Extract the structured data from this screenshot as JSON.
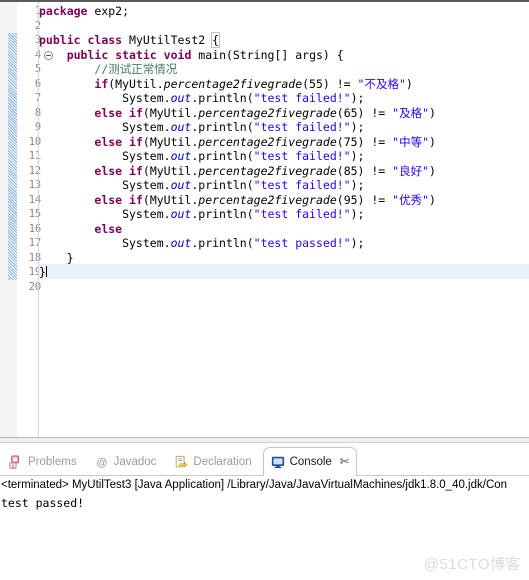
{
  "editor": {
    "gutter_start_line": 1,
    "total_lines": 20,
    "highlighted_line": 19,
    "fold_marker_line": 4,
    "change_bar_from_line": 3,
    "change_bar_to_line": 19,
    "colors": {
      "keyword": "#7f0055",
      "string": "#2a00ff",
      "comment": "#3f7f5f",
      "field": "#0000c0",
      "background": "#ffffff",
      "line_number": "#888888",
      "current_line_highlight": "#e8f2fe",
      "change_bar": "#c3d9f0"
    },
    "lines": [
      {
        "n": "1",
        "indent": 0,
        "tokens": [
          {
            "t": "package",
            "c": "kw"
          },
          {
            "t": " exp2;",
            "c": ""
          }
        ]
      },
      {
        "n": "2",
        "indent": 0,
        "tokens": []
      },
      {
        "n": "3",
        "indent": 0,
        "tokens": [
          {
            "t": "public",
            "c": "kw"
          },
          {
            "t": " ",
            "c": ""
          },
          {
            "t": "class",
            "c": "kw"
          },
          {
            "t": " MyUtilTest2 ",
            "c": ""
          },
          {
            "t": "{",
            "c": "brk"
          }
        ]
      },
      {
        "n": "4",
        "indent": 0,
        "tokens": [
          {
            "t": "    ",
            "c": ""
          },
          {
            "t": "public",
            "c": "kw"
          },
          {
            "t": " ",
            "c": ""
          },
          {
            "t": "static",
            "c": "kw"
          },
          {
            "t": " ",
            "c": ""
          },
          {
            "t": "void",
            "c": "kw"
          },
          {
            "t": " main(String[] args) {",
            "c": ""
          }
        ]
      },
      {
        "n": "5",
        "indent": 0,
        "tokens": [
          {
            "t": "        ",
            "c": ""
          },
          {
            "t": "//测试正常情况",
            "c": "cmt"
          }
        ]
      },
      {
        "n": "6",
        "indent": 0,
        "tokens": [
          {
            "t": "        ",
            "c": ""
          },
          {
            "t": "if",
            "c": "kw"
          },
          {
            "t": "(MyUtil.",
            "c": ""
          },
          {
            "t": "percentage2fivegrade",
            "c": "mth"
          },
          {
            "t": "(55) != ",
            "c": ""
          },
          {
            "t": "\"不及格\"",
            "c": "str"
          },
          {
            "t": ")",
            "c": ""
          }
        ]
      },
      {
        "n": "7",
        "indent": 0,
        "tokens": [
          {
            "t": "            System.",
            "c": ""
          },
          {
            "t": "out",
            "c": "fld"
          },
          {
            "t": ".println(",
            "c": ""
          },
          {
            "t": "\"test failed!\"",
            "c": "str"
          },
          {
            "t": ");",
            "c": ""
          }
        ]
      },
      {
        "n": "8",
        "indent": 0,
        "tokens": [
          {
            "t": "        ",
            "c": ""
          },
          {
            "t": "else",
            "c": "kw"
          },
          {
            "t": " ",
            "c": ""
          },
          {
            "t": "if",
            "c": "kw"
          },
          {
            "t": "(MyUtil.",
            "c": ""
          },
          {
            "t": "percentage2fivegrade",
            "c": "mth"
          },
          {
            "t": "(65) != ",
            "c": ""
          },
          {
            "t": "\"及格\"",
            "c": "str"
          },
          {
            "t": ")",
            "c": ""
          }
        ]
      },
      {
        "n": "9",
        "indent": 0,
        "tokens": [
          {
            "t": "            System.",
            "c": ""
          },
          {
            "t": "out",
            "c": "fld"
          },
          {
            "t": ".println(",
            "c": ""
          },
          {
            "t": "\"test failed!\"",
            "c": "str"
          },
          {
            "t": ");",
            "c": ""
          }
        ]
      },
      {
        "n": "10",
        "indent": 0,
        "tokens": [
          {
            "t": "        ",
            "c": ""
          },
          {
            "t": "else",
            "c": "kw"
          },
          {
            "t": " ",
            "c": ""
          },
          {
            "t": "if",
            "c": "kw"
          },
          {
            "t": "(MyUtil.",
            "c": ""
          },
          {
            "t": "percentage2fivegrade",
            "c": "mth"
          },
          {
            "t": "(75) != ",
            "c": ""
          },
          {
            "t": "\"中等\"",
            "c": "str"
          },
          {
            "t": ")",
            "c": ""
          }
        ]
      },
      {
        "n": "11",
        "indent": 0,
        "tokens": [
          {
            "t": "            System.",
            "c": ""
          },
          {
            "t": "out",
            "c": "fld"
          },
          {
            "t": ".println(",
            "c": ""
          },
          {
            "t": "\"test failed!\"",
            "c": "str"
          },
          {
            "t": ");",
            "c": ""
          }
        ]
      },
      {
        "n": "12",
        "indent": 0,
        "tokens": [
          {
            "t": "        ",
            "c": ""
          },
          {
            "t": "else",
            "c": "kw"
          },
          {
            "t": " ",
            "c": ""
          },
          {
            "t": "if",
            "c": "kw"
          },
          {
            "t": "(MyUtil.",
            "c": ""
          },
          {
            "t": "percentage2fivegrade",
            "c": "mth"
          },
          {
            "t": "(85) != ",
            "c": ""
          },
          {
            "t": "\"良好\"",
            "c": "str"
          },
          {
            "t": ")",
            "c": ""
          }
        ]
      },
      {
        "n": "13",
        "indent": 0,
        "tokens": [
          {
            "t": "            System.",
            "c": ""
          },
          {
            "t": "out",
            "c": "fld"
          },
          {
            "t": ".println(",
            "c": ""
          },
          {
            "t": "\"test failed!\"",
            "c": "str"
          },
          {
            "t": ");",
            "c": ""
          }
        ]
      },
      {
        "n": "14",
        "indent": 0,
        "tokens": [
          {
            "t": "        ",
            "c": ""
          },
          {
            "t": "else",
            "c": "kw"
          },
          {
            "t": " ",
            "c": ""
          },
          {
            "t": "if",
            "c": "kw"
          },
          {
            "t": "(MyUtil.",
            "c": ""
          },
          {
            "t": "percentage2fivegrade",
            "c": "mth"
          },
          {
            "t": "(95) != ",
            "c": ""
          },
          {
            "t": "\"优秀\"",
            "c": "str"
          },
          {
            "t": ")",
            "c": ""
          }
        ]
      },
      {
        "n": "15",
        "indent": 0,
        "tokens": [
          {
            "t": "            System.",
            "c": ""
          },
          {
            "t": "out",
            "c": "fld"
          },
          {
            "t": ".println(",
            "c": ""
          },
          {
            "t": "\"test failed!\"",
            "c": "str"
          },
          {
            "t": ");",
            "c": ""
          }
        ]
      },
      {
        "n": "16",
        "indent": 0,
        "tokens": [
          {
            "t": "        ",
            "c": ""
          },
          {
            "t": "else",
            "c": "kw"
          }
        ]
      },
      {
        "n": "17",
        "indent": 0,
        "tokens": [
          {
            "t": "            System.",
            "c": ""
          },
          {
            "t": "out",
            "c": "fld"
          },
          {
            "t": ".println(",
            "c": ""
          },
          {
            "t": "\"test passed!\"",
            "c": "str"
          },
          {
            "t": ");",
            "c": ""
          }
        ]
      },
      {
        "n": "18",
        "indent": 0,
        "tokens": [
          {
            "t": "    }",
            "c": ""
          }
        ]
      },
      {
        "n": "19",
        "indent": 0,
        "tokens": [
          {
            "t": "}",
            "c": ""
          }
        ],
        "caret": true
      },
      {
        "n": "20",
        "indent": 0,
        "tokens": []
      }
    ]
  },
  "panel": {
    "tabs": [
      {
        "label": "Problems",
        "icon": "problems-icon",
        "active": false,
        "closable": false
      },
      {
        "label": "Javadoc",
        "icon": "javadoc-icon",
        "active": false,
        "closable": false
      },
      {
        "label": "Declaration",
        "icon": "declaration-icon",
        "active": false,
        "closable": false
      },
      {
        "label": "Console",
        "icon": "console-icon",
        "active": true,
        "closable": true,
        "close_glyph": "✄"
      }
    ],
    "console": {
      "status_line": "<terminated> MyUtilTest3 [Java Application] /Library/Java/JavaVirtualMachines/jdk1.8.0_40.jdk/Con",
      "output": "test passed!"
    }
  },
  "watermark": "@51CTO博客"
}
